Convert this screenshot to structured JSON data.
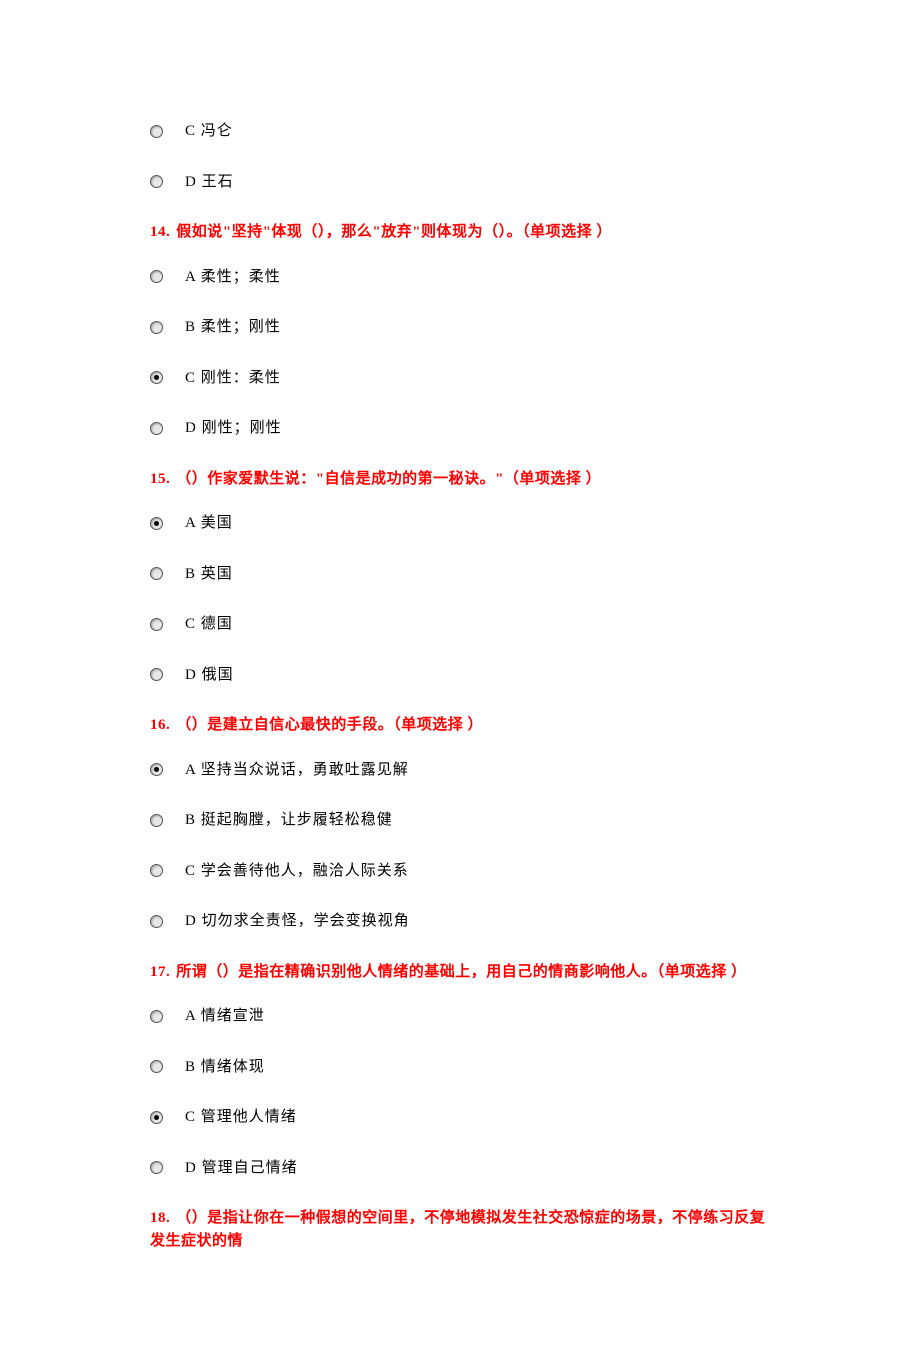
{
  "pre_options": [
    {
      "label": "C 冯仑",
      "selected": false
    },
    {
      "label": "D 王石",
      "selected": false
    }
  ],
  "questions": [
    {
      "num": "14.",
      "text": "假如说\"坚持\"体现（），那么\"放弃\"则体现为（）。（单项选择 ）",
      "options": [
        {
          "label": "A 柔性；柔性",
          "selected": false
        },
        {
          "label": "B 柔性；刚性",
          "selected": false
        },
        {
          "label": "C 刚性：柔性",
          "selected": true
        },
        {
          "label": "D 刚性；刚性",
          "selected": false
        }
      ]
    },
    {
      "num": "15.",
      "text": "（）作家爱默生说：\"自信是成功的第一秘诀。\"（单项选择 ）",
      "options": [
        {
          "label": "A 美国",
          "selected": true
        },
        {
          "label": "B 英国",
          "selected": false
        },
        {
          "label": "C 德国",
          "selected": false
        },
        {
          "label": "D 俄国",
          "selected": false
        }
      ]
    },
    {
      "num": "16.",
      "text": "（）是建立自信心最快的手段。（单项选择 ）",
      "options": [
        {
          "label": "A 坚持当众说话，勇敢吐露见解",
          "selected": true
        },
        {
          "label": "B 挺起胸膛，让步履轻松稳健",
          "selected": false
        },
        {
          "label": "C 学会善待他人，融洽人际关系",
          "selected": false
        },
        {
          "label": "D 切勿求全责怪，学会变换视角",
          "selected": false
        }
      ]
    },
    {
      "num": "17.",
      "text": "所谓（）是指在精确识别他人情绪的基础上，用自己的情商影响他人。（单项选择 ）",
      "options": [
        {
          "label": "A 情绪宣泄",
          "selected": false
        },
        {
          "label": "B 情绪体现",
          "selected": false
        },
        {
          "label": "C 管理他人情绪",
          "selected": true
        },
        {
          "label": "D 管理自己情绪",
          "selected": false
        }
      ]
    },
    {
      "num": "18.",
      "text": "（）是指让你在一种假想的空间里，不停地模拟发生社交恐惊症的场景，不停练习反复发生症状的情",
      "options": []
    }
  ]
}
